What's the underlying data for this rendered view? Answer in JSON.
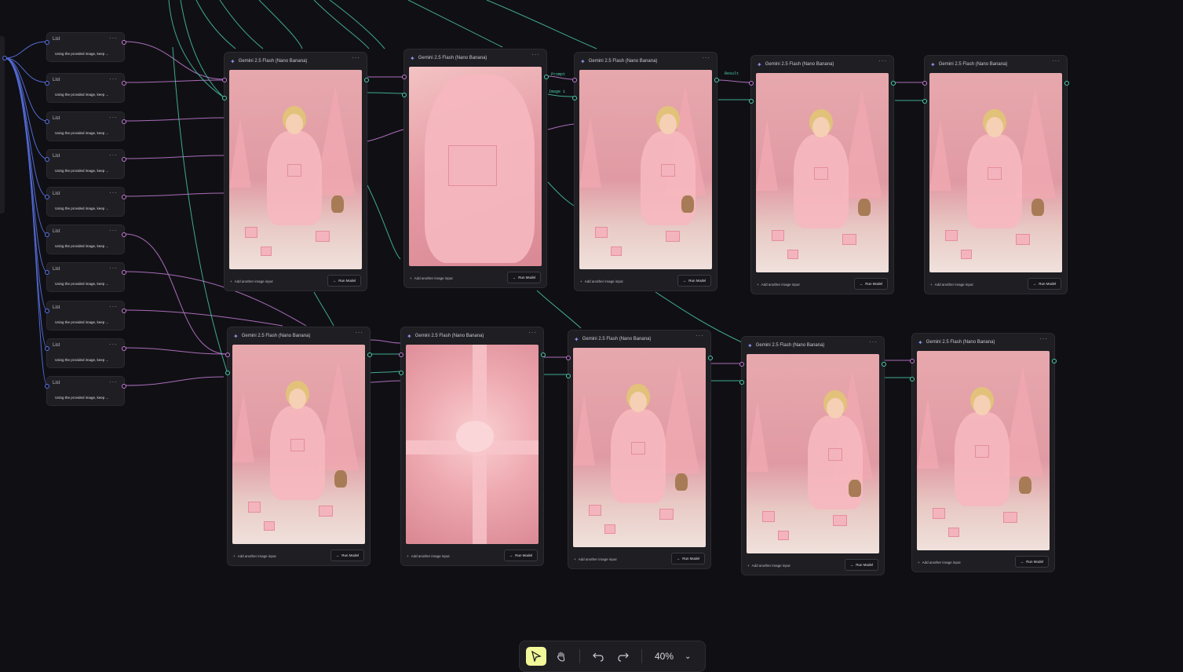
{
  "canvas": {
    "background": "#101014"
  },
  "colors": {
    "prompt_wire": "#c57bd6",
    "image_wire": "#4ccfae",
    "list_wire": "#5a73e8",
    "active_tool": "#f2f79a"
  },
  "list_nodes": [
    {
      "title": "List",
      "preview": "Using the provided image, keep ..."
    },
    {
      "title": "List",
      "preview": "Using the provided image, keep ..."
    },
    {
      "title": "List",
      "preview": "Using the provided image, keep ..."
    },
    {
      "title": "List",
      "preview": "Using the provided image, keep ..."
    },
    {
      "title": "List",
      "preview": "Using the provided image, keep ..."
    },
    {
      "title": "List",
      "preview": "Using the provided image, keep ..."
    },
    {
      "title": "List",
      "preview": "Using the provided image, keep ..."
    },
    {
      "title": "List",
      "preview": "Using the provided image, keep ..."
    },
    {
      "title": "List",
      "preview": "Using the provided image, keep ..."
    },
    {
      "title": "List",
      "preview": "Using the provided image, keep ..."
    }
  ],
  "model_nodes": [
    {
      "title": "Gemini 2.5 Flash (Nano Banana)",
      "add_label": "Add another image input",
      "run_label": "Run Model",
      "image": "woman in pink pajamas with christmas tree and dog"
    },
    {
      "title": "Gemini 2.5 Flash (Nano Banana)",
      "add_label": "Add another image input",
      "run_label": "Run Model",
      "image": "close-up of hands holding pink gift"
    },
    {
      "title": "Gemini 2.5 Flash (Nano Banana)",
      "add_label": "Add another image input",
      "run_label": "Run Model",
      "image": "side view of woman with gift and tree"
    },
    {
      "title": "Gemini 2.5 Flash (Nano Banana)",
      "add_label": "Add another image input",
      "run_label": "Run Model",
      "image": "wide shot of pink room with tree"
    },
    {
      "title": "Gemini 2.5 Flash (Nano Banana)",
      "add_label": "Add another image input",
      "run_label": "Run Model",
      "image": "smiling woman holding gift"
    },
    {
      "title": "Gemini 2.5 Flash (Nano Banana)",
      "add_label": "Add another image input",
      "run_label": "Run Model",
      "image": "woman sitting with gifts and dog"
    },
    {
      "title": "Gemini 2.5 Flash (Nano Banana)",
      "add_label": "Add another image input",
      "run_label": "Run Model",
      "image": "pink gift box with satin bow"
    },
    {
      "title": "Gemini 2.5 Flash (Nano Banana)",
      "add_label": "Add another image input",
      "run_label": "Run Model",
      "image": "woman on floor with gift boxes"
    },
    {
      "title": "Gemini 2.5 Flash (Nano Banana)",
      "add_label": "Add another image input",
      "run_label": "Run Model",
      "image": "laughing woman with dog and gift"
    },
    {
      "title": "Gemini 2.5 Flash (Nano Banana)",
      "add_label": "Add another image input",
      "run_label": "Run Model",
      "image": "woman cross-legged with dog and tree"
    }
  ],
  "edge_labels": [
    "Prompt",
    "Image 1",
    "Result"
  ],
  "toolbar": {
    "select_icon": "cursor-arrow",
    "hand_icon": "hand",
    "undo_icon": "undo-arrow",
    "redo_icon": "redo-arrow",
    "zoom": "40%"
  }
}
